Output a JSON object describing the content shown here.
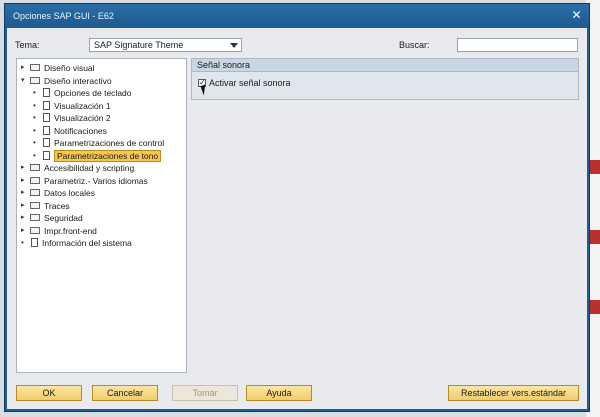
{
  "window": {
    "title": "Opciones SAP GUI - E62",
    "close_glyph": "✕"
  },
  "theme": {
    "label": "Tema:",
    "value": "SAP Signature Theme"
  },
  "search": {
    "label": "Buscar:",
    "value": ""
  },
  "tree": {
    "nodes": [
      {
        "label": "Diseño visual",
        "icon": "folder-icon",
        "exp": "▸"
      },
      {
        "label": "Diseño interactivo",
        "icon": "folder-open-icon",
        "exp": "▾"
      },
      {
        "label": "Opciones de teclado",
        "icon": "document-icon"
      },
      {
        "label": "Visualización 1",
        "icon": "document-icon"
      },
      {
        "label": "Visualización 2",
        "icon": "document-icon"
      },
      {
        "label": "Notificaciones",
        "icon": "document-icon"
      },
      {
        "label": "Parametrizaciones de control",
        "icon": "document-icon"
      },
      {
        "label": "Parametrizaciones de tono",
        "icon": "document-icon",
        "selected": true
      },
      {
        "label": "Accesibilidad y scripting",
        "icon": "folder-icon",
        "exp": "▸"
      },
      {
        "label": "Parametriz.- Varios idiomas",
        "icon": "folder-icon",
        "exp": "▸"
      },
      {
        "label": "Datos locales",
        "icon": "folder-icon",
        "exp": "▸"
      },
      {
        "label": "Traces",
        "icon": "folder-icon",
        "exp": "▸"
      },
      {
        "label": "Seguridad",
        "icon": "folder-icon",
        "exp": "▸"
      },
      {
        "label": "Impr.front-end",
        "icon": "folder-icon",
        "exp": "▸"
      },
      {
        "label": "Información del sistema",
        "icon": "document-icon"
      }
    ]
  },
  "panel": {
    "group_title": "Señal sonora",
    "checkbox_label": "Activar señal sonora",
    "checkbox_checked": true
  },
  "buttons": {
    "ok": "OK",
    "cancel": "Cancelar",
    "apply": "Tomar",
    "help": "Ayuda",
    "reset": "Restablecer vers.estándar"
  },
  "colors": {
    "titlebar": "#1f5e93",
    "selection": "#f6c64e",
    "button": "#f1cd6a"
  }
}
